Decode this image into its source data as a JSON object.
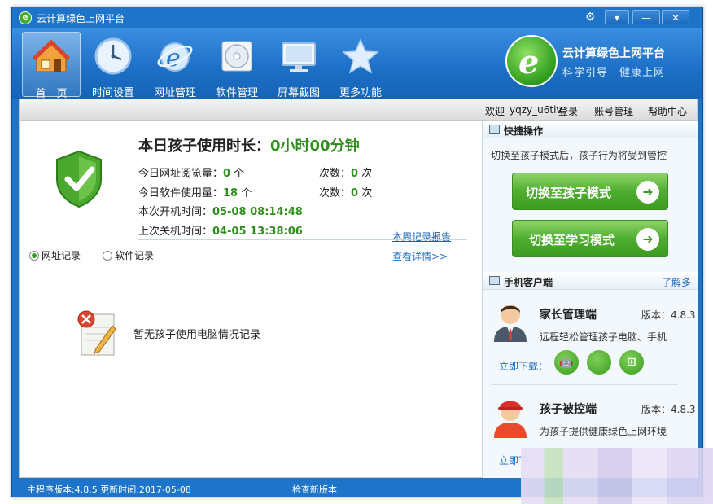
{
  "window": {
    "title": "云计算绿色上网平台"
  },
  "toolbar": {
    "items": [
      {
        "label": "首　页"
      },
      {
        "label": "时间设置"
      },
      {
        "label": "网址管理"
      },
      {
        "label": "软件管理"
      },
      {
        "label": "屏幕截图"
      },
      {
        "label": "更多功能"
      }
    ]
  },
  "brand": {
    "title": "云计算绿色上网平台",
    "subtitle": "科学引导　健康上网"
  },
  "account": {
    "welcome": "欢迎",
    "username": "yqzy_u6tiv",
    "login": "登录",
    "manage": "账号管理",
    "help": "帮助中心"
  },
  "usage": {
    "title": "本日孩子使用时长：",
    "hours": "0",
    "hour_unit": "小时",
    "minutes": "00",
    "minute_unit": "分钟",
    "url_label": "今日网址阅览量：",
    "url_count": "0",
    "url_unit": "个",
    "url_times_label": "次数：",
    "url_times": "0",
    "url_times_unit": "次",
    "app_label": "今日软件使用量：",
    "app_count": "18",
    "app_unit": "个",
    "app_times_label": "次数：",
    "app_times": "0",
    "app_times_unit": "次",
    "boot_label": "本次开机时间：",
    "boot_time": "05-08 08:14:48",
    "shutdown_label": "上次关机时间：",
    "shutdown_time": "04-05 13:38:06",
    "weekly_report": "本周记录报告"
  },
  "records": {
    "tab_web": "网址记录",
    "tab_app": "软件记录",
    "details": "查看详情>>",
    "empty": "暂无孩子使用电脑情况记录"
  },
  "quick": {
    "title": "快捷操作",
    "hint": "切换至孩子模式后，孩子行为将受到管控",
    "child_mode": "切换至孩子模式",
    "study_mode": "切换至学习模式"
  },
  "mobile": {
    "title": "手机客户端",
    "more": "了解多",
    "parent": {
      "name": "家长管理端",
      "version": "版本：4.8.3",
      "desc": "远程轻松管理孩子电脑、手机",
      "download": "立即下载："
    },
    "child": {
      "name": "孩子被控端",
      "version": "版本：4.8.3",
      "desc": "为孩子提供健康绿色上网环境",
      "download": "立即下"
    }
  },
  "status": {
    "version": "主程序版本:4.8.5 更新时间:2017-05-08",
    "check": "检查新版本"
  },
  "colors": {
    "frame": "#1e74c8",
    "accent_green": "#3d9b21",
    "value_green": "#2f8e1d",
    "link_blue": "#1060b8"
  }
}
